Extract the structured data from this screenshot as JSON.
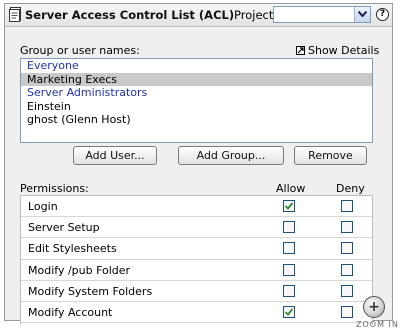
{
  "header": {
    "title": "Server Access Control List (ACL)",
    "project_label": "Project",
    "project_value": "",
    "icon": "document-icon",
    "help_icon_text": "?"
  },
  "groups": {
    "label": "Group or user names:",
    "show_details": "Show Details",
    "items": [
      {
        "label": "Everyone",
        "type": "group",
        "selected": false
      },
      {
        "label": "Marketing Execs",
        "type": "group",
        "selected": true
      },
      {
        "label": "Server Administrators",
        "type": "group",
        "selected": false
      },
      {
        "label": "Einstein",
        "type": "user",
        "selected": false
      },
      {
        "label": "ghost (Glenn Host)",
        "type": "user",
        "selected": false
      }
    ]
  },
  "buttons": {
    "add_user": "Add User...",
    "add_group": "Add Group...",
    "remove": "Remove"
  },
  "permissions": {
    "label": "Permissions:",
    "allow_header": "Allow",
    "deny_header": "Deny",
    "rows": [
      {
        "name": "Login",
        "allow": true,
        "deny": false
      },
      {
        "name": "Server Setup",
        "allow": false,
        "deny": false
      },
      {
        "name": "Edit Stylesheets",
        "allow": false,
        "deny": false
      },
      {
        "name": "Modify /pub Folder",
        "allow": false,
        "deny": false
      },
      {
        "name": "Modify System Folders",
        "allow": false,
        "deny": false
      },
      {
        "name": "Modify Account",
        "allow": true,
        "deny": false
      }
    ]
  },
  "zoom": {
    "label": "ZOOM IN",
    "icon_text": "+"
  },
  "colors": {
    "group_text": "#2233aa",
    "selected_bg": "#c9c9c9",
    "check": "#2e8b2e"
  }
}
